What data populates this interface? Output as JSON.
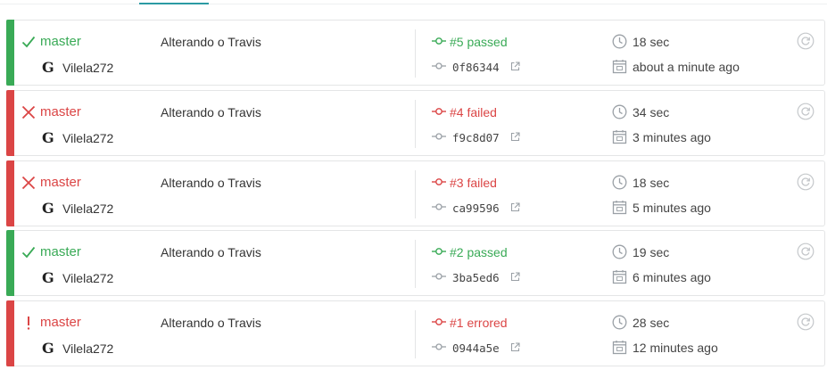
{
  "colors": {
    "passed": "#39aa56",
    "failed": "#db4545",
    "errored": "#db4545",
    "tab_active": "#2b9aa3"
  },
  "builds": [
    {
      "state": "passed",
      "status_icon": "check-icon",
      "branch": "master",
      "author": "Vilela272",
      "message": "Alterando o Travis",
      "number": "#5 passed",
      "sha": "0f86344",
      "duration": "18 sec",
      "finished": "about a minute ago"
    },
    {
      "state": "failed",
      "status_icon": "cross-icon",
      "branch": "master",
      "author": "Vilela272",
      "message": "Alterando o Travis",
      "number": "#4 failed",
      "sha": "f9c8d07",
      "duration": "34 sec",
      "finished": "3 minutes ago"
    },
    {
      "state": "failed",
      "status_icon": "cross-icon",
      "branch": "master",
      "author": "Vilela272",
      "message": "Alterando o Travis",
      "number": "#3 failed",
      "sha": "ca99596",
      "duration": "18 sec",
      "finished": "5 minutes ago"
    },
    {
      "state": "passed",
      "status_icon": "check-icon",
      "branch": "master",
      "author": "Vilela272",
      "message": "Alterando o Travis",
      "number": "#2 passed",
      "sha": "3ba5ed6",
      "duration": "19 sec",
      "finished": "6 minutes ago"
    },
    {
      "state": "errored",
      "status_icon": "exclamation-icon",
      "branch": "master",
      "author": "Vilela272",
      "message": "Alterando o Travis",
      "number": "#1 errored",
      "sha": "0944a5e",
      "duration": "28 sec",
      "finished": "12 minutes ago"
    }
  ]
}
